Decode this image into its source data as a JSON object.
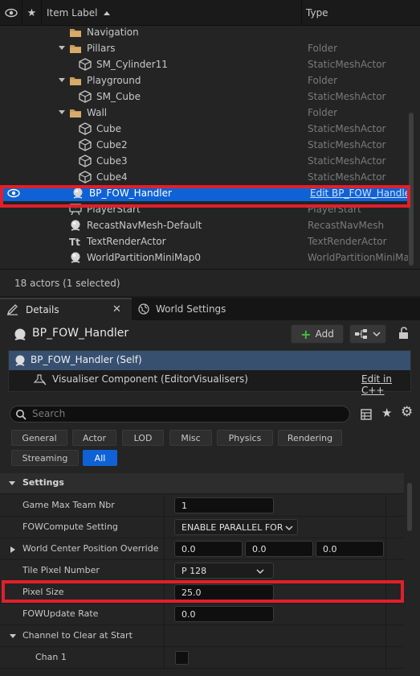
{
  "outliner": {
    "columns": {
      "label": "Item Label",
      "type": "Type"
    },
    "rows": [
      {
        "label": "Navigation",
        "type": "",
        "kind": "folder",
        "depth": 2,
        "arrow": ""
      },
      {
        "label": "Pillars",
        "type": "Folder",
        "kind": "folder",
        "depth": 2,
        "arrow": "down"
      },
      {
        "label": "SM_Cylinder11",
        "type": "StaticMeshActor",
        "kind": "mesh",
        "depth": 3,
        "arrow": ""
      },
      {
        "label": "Playground",
        "type": "Folder",
        "kind": "folder",
        "depth": 2,
        "arrow": "down"
      },
      {
        "label": "SM_Cube",
        "type": "StaticMeshActor",
        "kind": "mesh",
        "depth": 3,
        "arrow": ""
      },
      {
        "label": "Wall",
        "type": "Folder",
        "kind": "folder",
        "depth": 2,
        "arrow": "down"
      },
      {
        "label": "Cube",
        "type": "StaticMeshActor",
        "kind": "mesh",
        "depth": 3,
        "arrow": ""
      },
      {
        "label": "Cube2",
        "type": "StaticMeshActor",
        "kind": "mesh",
        "depth": 3,
        "arrow": ""
      },
      {
        "label": "Cube3",
        "type": "StaticMeshActor",
        "kind": "mesh",
        "depth": 3,
        "arrow": ""
      },
      {
        "label": "Cube4",
        "type": "StaticMeshActor",
        "kind": "mesh",
        "depth": 3,
        "arrow": ""
      },
      {
        "label": "BP_FOW_Handler",
        "type": "Edit BP_FOW_Handle",
        "kind": "sphere",
        "depth": 1,
        "arrow": "",
        "selected": true
      },
      {
        "label": "PlayerStart",
        "type": "PlayerStart",
        "kind": "flag",
        "depth": 1,
        "arrow": ""
      },
      {
        "label": "RecastNavMesh-Default",
        "type": "RecastNavMesh",
        "kind": "sphere",
        "depth": 1,
        "arrow": ""
      },
      {
        "label": "TextRenderActor",
        "type": "TextRenderActor",
        "kind": "text",
        "depth": 1,
        "arrow": ""
      },
      {
        "label": "WorldPartitionMiniMap0",
        "type": "WorldPartitionMiniMa",
        "kind": "sphere",
        "depth": 1,
        "arrow": ""
      }
    ],
    "status": "18 actors (1 selected)"
  },
  "tabs": {
    "details": "Details",
    "world_settings": "World Settings"
  },
  "details": {
    "actor_name": "BP_FOW_Handler",
    "add_label": "Add",
    "self_item": "BP_FOW_Handler (Self)",
    "component_item": "Visualiser Component (EditorVisualisers)",
    "edit_cpp": "Edit in C++",
    "search_placeholder": "Search",
    "filters_row1": [
      "General",
      "Actor",
      "LOD",
      "Misc",
      "Physics",
      "Rendering"
    ],
    "filters_row2": [
      "Streaming",
      "All"
    ],
    "active_filter": "All",
    "section": "Settings",
    "properties": {
      "game_max_team_nbr": {
        "label": "Game Max Team Nbr",
        "value": "1"
      },
      "fow_compute": {
        "label": "FOWCompute Setting",
        "value": "ENABLE PARALLEL FOR"
      },
      "world_center": {
        "label": "World Center Position Override",
        "x": "0.0",
        "y": "0.0",
        "z": "0.0"
      },
      "tile_pixel": {
        "label": "Tile Pixel Number",
        "value": "P 128"
      },
      "pixel_size": {
        "label": "Pixel Size",
        "value": "25.0"
      },
      "fow_update_rate": {
        "label": "FOWUpdate Rate",
        "value": "0.0"
      },
      "channel_clear": {
        "label": "Channel to Clear at Start"
      },
      "chan1": {
        "label": "Chan 1",
        "checked": false
      }
    }
  },
  "colors": {
    "selection": "#0f62d6",
    "highlight": "#e0202a",
    "add_icon": "#3fbf3f",
    "folder": "#c79a5a"
  }
}
